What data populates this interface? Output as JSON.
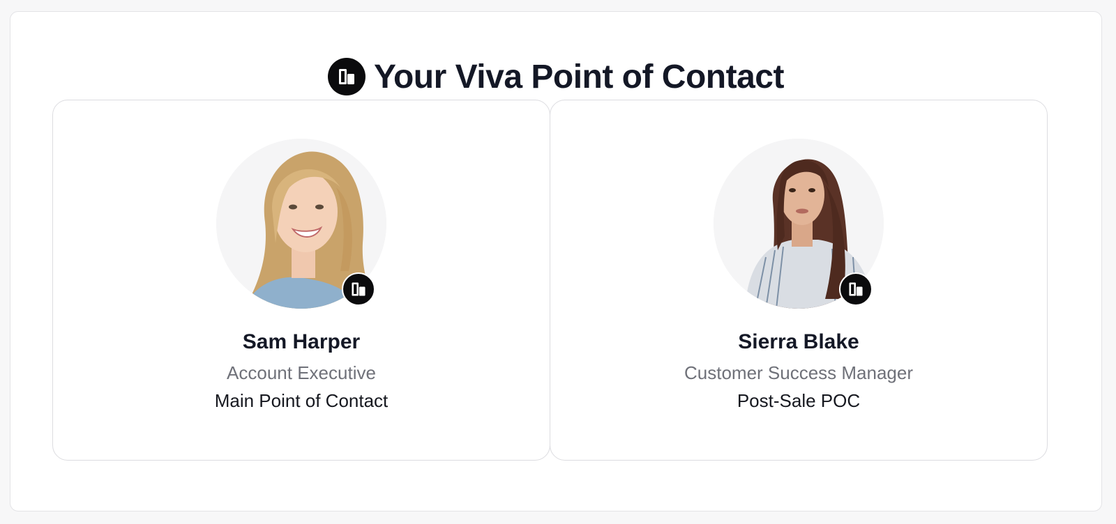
{
  "header": {
    "title": "Your Viva Point of Contact",
    "logo_icon": "viva-logo-icon"
  },
  "contacts": [
    {
      "name": "Sam Harper",
      "title": "Account Executive",
      "role": "Main Point of Contact",
      "avatar": "photo-blonde-smiling-woman"
    },
    {
      "name": "Sierra Blake",
      "title": "Customer Success Manager",
      "role": "Post-Sale POC",
      "avatar": "photo-brunette-woman-striped-shirt"
    }
  ],
  "colors": {
    "heading": "#141826",
    "subtitle": "#6f7179",
    "badge": "#0b0b0d",
    "card_border": "#dcdce0"
  }
}
